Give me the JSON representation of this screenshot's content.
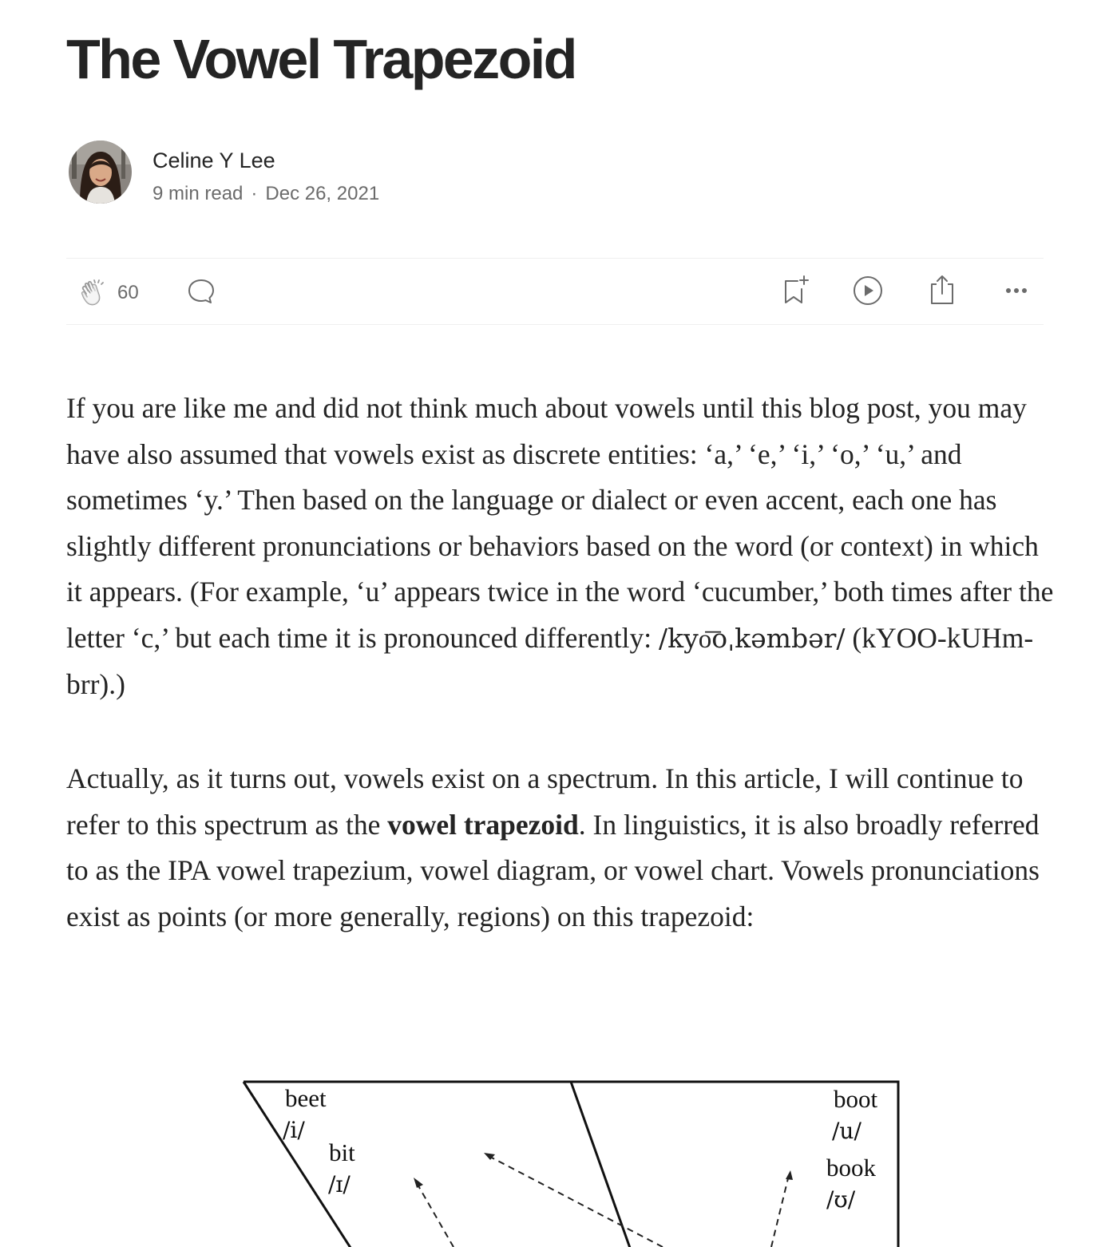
{
  "article": {
    "title": "The Vowel Trapezoid",
    "author": "Celine Y Lee",
    "read_time": "9 min read",
    "separator": "·",
    "date": "Dec 26, 2021"
  },
  "actions": {
    "clap_count": "60",
    "icons": [
      "clap-icon",
      "comment-icon",
      "bookmark-icon",
      "listen-icon",
      "share-icon",
      "more-icon"
    ]
  },
  "body": {
    "p1": "If you are like me and did not think much about vowels until this blog post, you may have also assumed that vowels exist as discrete entities: ‘a,’ ‘e,’ ‘i,’ ‘o,’ ‘u,’ and sometimes ‘y.’ Then based on the language or dialect or even accent, each one has slightly different pronunciations or behaviors based on the word (or context) in which it appears. (For example, ‘u’ appears twice in the word ‘cucumber,’ both times after the letter ‘c,’ but each time it is pronounced differently: ",
    "p1_ipa": "/kyo͞oˌkəmbər/",
    "p1_tail": " (kYOO-kUHm-brr).)",
    "p2_before": "Actually, as it turns out, vowels exist on a spectrum. In this article, I will continue to refer to this spectrum as the ",
    "p2_bold": "vowel trapezoid",
    "p2_after": ". In linguistics, it is also broadly referred to as the IPA vowel trapezium, vowel diagram, or vowel chart. Vowels pronunciations exist as points (or more generally, regions) on this trapezoid:"
  },
  "figure": {
    "labels": {
      "beet": "beet",
      "beet_ipa": "/i/",
      "bit": "bit",
      "bit_ipa": "/ɪ/",
      "boot": "boot",
      "boot_ipa": "/u/",
      "book": "book",
      "book_ipa": "/ʊ/"
    }
  },
  "colors": {
    "text": "#242424",
    "muted": "#6b6b6b",
    "divider": "#f0f0f0"
  }
}
